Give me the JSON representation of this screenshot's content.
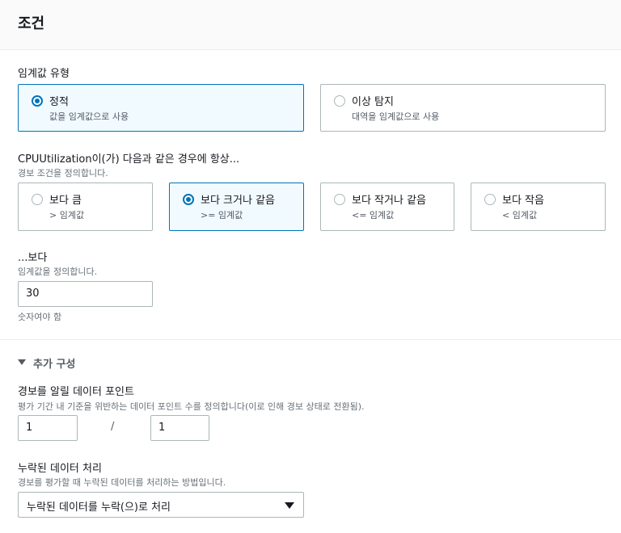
{
  "header": {
    "title": "조건"
  },
  "threshold_type": {
    "label": "임계값 유형",
    "options": [
      {
        "title": "정적",
        "sub": "값을 임계값으로 사용",
        "selected": true
      },
      {
        "title": "이상 탐지",
        "sub": "대역을 임계값으로 사용",
        "selected": false
      }
    ]
  },
  "condition": {
    "label": "CPUUtilization이(가) 다음과 같은 경우에 항상...",
    "desc": "경보 조건을 정의합니다.",
    "options": [
      {
        "title": "보다 큼",
        "sub": "> 임계값",
        "selected": false
      },
      {
        "title": "보다 크거나 같음",
        "sub": ">= 임계값",
        "selected": true
      },
      {
        "title": "보다 작거나 같음",
        "sub": "<= 임계값",
        "selected": false
      },
      {
        "title": "보다 작음",
        "sub": "< 임계값",
        "selected": false
      }
    ]
  },
  "than": {
    "label": "...보다",
    "desc": "임계값을 정의합니다.",
    "value": "30",
    "hint": "숫자여야 함"
  },
  "additional": {
    "toggle_label": "추가 구성",
    "datapoints": {
      "label": "경보를 알릴 데이터 포인트",
      "desc": "평가 기간 내 기준을 위반하는 데이터 포인트 수를 정의합니다(이로 인해 경보 상태로 전환됨).",
      "value_a": "1",
      "separator": "/",
      "value_b": "1"
    },
    "missing": {
      "label": "누락된 데이터 처리",
      "desc": "경보를 평가할 때 누락된 데이터를 처리하는 방법입니다.",
      "selected": "누락된 데이터를 누락(으)로 처리"
    }
  },
  "colors": {
    "accent": "#0073bb",
    "selected_bg": "#f1faff",
    "border": "#aab7b8"
  }
}
